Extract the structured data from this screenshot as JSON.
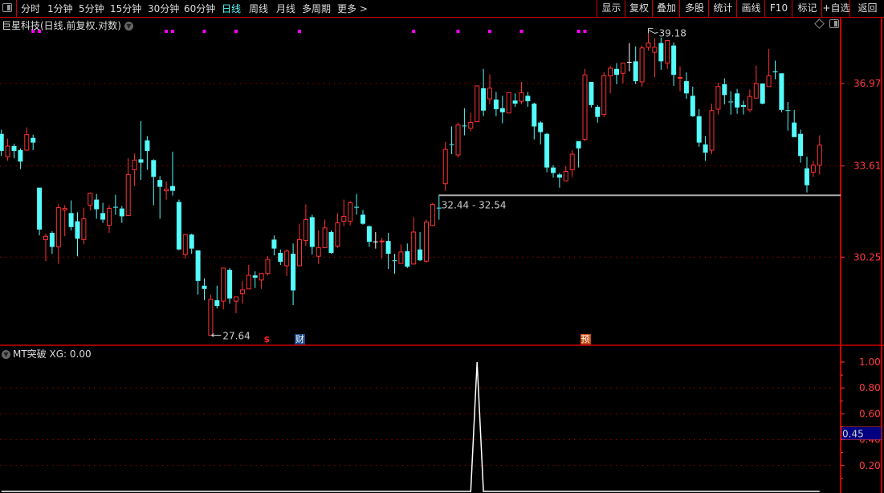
{
  "topbar": {
    "tabs": [
      "分时",
      "1分钟",
      "5分钟",
      "15分钟",
      "30分钟",
      "60分钟",
      "日线",
      "周线",
      "月线",
      "多周期",
      "更多 >"
    ],
    "active_tab": "日线",
    "buttons": [
      "显示",
      "复权",
      "叠加",
      "多股",
      "统计",
      "画线",
      "F10",
      "标记",
      "+自选",
      "返回"
    ]
  },
  "main": {
    "title": "巨星科技(日线.前复权.对数)",
    "price_ticks": [
      36.97,
      33.61,
      30.25
    ],
    "scale": "log",
    "high_label": "39.18",
    "low_label": "27.64",
    "range_label": "32.44 - 32.54",
    "range_line_price": 32.49,
    "event_markers": [
      {
        "candle": 42,
        "text": "$",
        "kind": "dividend"
      },
      {
        "candle": 47,
        "text": "财",
        "kind": "report"
      },
      {
        "candle": 92,
        "text": "预",
        "kind": "forecast"
      }
    ],
    "signal_marks": [
      5,
      6,
      26,
      27,
      32,
      37,
      47,
      65,
      72,
      77,
      82,
      91,
      92
    ],
    "candles": [
      [
        34.88,
        35.05,
        34.0,
        34.2
      ],
      [
        33.97,
        34.69,
        33.81,
        34.39
      ],
      [
        34.39,
        34.49,
        33.91,
        34.2
      ],
      [
        34.23,
        34.3,
        33.49,
        33.78
      ],
      [
        34.23,
        35.14,
        34.23,
        34.85
      ],
      [
        34.72,
        34.85,
        34.23,
        34.53
      ],
      [
        32.78,
        32.78,
        31.02,
        31.23
      ],
      [
        30.87,
        31.08,
        30.11,
        30.99
      ],
      [
        31.11,
        31.17,
        30.37,
        30.61
      ],
      [
        30.61,
        32.18,
        30.01,
        32.03
      ],
      [
        31.94,
        32.12,
        30.99,
        32.0
      ],
      [
        31.83,
        32.3,
        31.2,
        31.32
      ],
      [
        31.53,
        31.86,
        30.28,
        30.9
      ],
      [
        30.87,
        32.03,
        30.7,
        31.62
      ],
      [
        32.12,
        32.6,
        31.92,
        32.57
      ],
      [
        32.33,
        32.54,
        31.62,
        31.97
      ],
      [
        31.83,
        32.21,
        31.47,
        31.59
      ],
      [
        31.38,
        32.12,
        31.11,
        32.0
      ],
      [
        32.06,
        32.51,
        31.77,
        32.03
      ],
      [
        32.0,
        32.09,
        31.47,
        31.71
      ],
      [
        31.74,
        33.91,
        31.74,
        33.28
      ],
      [
        33.46,
        34.1,
        32.84,
        33.84
      ],
      [
        33.87,
        35.4,
        33.07,
        33.74
      ],
      [
        34.62,
        34.79,
        33.46,
        34.2
      ],
      [
        33.84,
        33.87,
        32.12,
        33.19
      ],
      [
        33.07,
        33.22,
        31.62,
        32.81
      ],
      [
        32.66,
        33.02,
        32.33,
        32.72
      ],
      [
        32.84,
        34.17,
        32.48,
        32.66
      ],
      [
        32.24,
        32.33,
        30.49,
        30.52
      ],
      [
        30.34,
        31.05,
        30.2,
        31.05
      ],
      [
        31.05,
        31.08,
        30.37,
        30.55
      ],
      [
        30.49,
        30.49,
        28.97,
        29.43
      ],
      [
        29.27,
        29.52,
        28.78,
        29.16
      ],
      [
        27.64,
        28.97,
        27.64,
        28.81
      ],
      [
        28.78,
        29.27,
        28.51,
        28.59
      ],
      [
        28.75,
        29.87,
        28.48,
        29.87
      ],
      [
        29.81,
        29.87,
        28.67,
        28.84
      ],
      [
        28.75,
        28.89,
        28.35,
        28.89
      ],
      [
        29.0,
        29.43,
        28.67,
        29.13
      ],
      [
        29.16,
        29.98,
        29.16,
        29.62
      ],
      [
        29.62,
        29.76,
        29.19,
        29.54
      ],
      [
        29.46,
        29.68,
        29.16,
        29.68
      ],
      [
        29.68,
        30.28,
        29.62,
        30.17
      ],
      [
        30.87,
        31.02,
        30.31,
        30.55
      ],
      [
        30.4,
        30.52,
        29.98,
        30.09
      ],
      [
        29.95,
        30.52,
        29.6,
        30.46
      ],
      [
        30.37,
        30.73,
        28.62,
        29.11
      ],
      [
        29.95,
        31.44,
        29.95,
        30.87
      ],
      [
        30.84,
        32.15,
        30.64,
        31.59
      ],
      [
        31.68,
        31.77,
        30.34,
        30.61
      ],
      [
        30.28,
        31.2,
        30.01,
        30.58
      ],
      [
        30.58,
        31.59,
        30.58,
        31.29
      ],
      [
        31.14,
        31.2,
        30.37,
        30.4
      ],
      [
        30.64,
        31.83,
        30.58,
        31.47
      ],
      [
        31.53,
        32.33,
        31.35,
        31.71
      ],
      [
        31.53,
        32.27,
        31.38,
        32.21
      ],
      [
        32.06,
        32.54,
        31.77,
        32.03
      ],
      [
        31.77,
        31.94,
        31.41,
        31.44
      ],
      [
        31.35,
        31.38,
        30.61,
        30.79
      ],
      [
        30.79,
        31.14,
        30.55,
        30.79
      ],
      [
        30.79,
        30.93,
        30.2,
        30.82
      ],
      [
        30.82,
        31.11,
        29.84,
        30.37
      ],
      [
        30.14,
        30.37,
        29.68,
        30.11
      ],
      [
        30.03,
        30.7,
        30.03,
        30.43
      ],
      [
        30.46,
        30.73,
        29.87,
        29.92
      ],
      [
        30.01,
        31.68,
        30.01,
        31.14
      ],
      [
        30.52,
        31.14,
        30.11,
        30.14
      ],
      [
        30.11,
        31.59,
        30.06,
        31.5
      ],
      [
        31.38,
        32.21,
        31.35,
        32.15
      ],
      [
        32.03,
        32.51,
        31.59,
        32.0
      ],
      [
        32.93,
        34.56,
        32.66,
        34.26
      ],
      [
        34.45,
        35.18,
        34.07,
        34.43
      ],
      [
        34.04,
        35.34,
        33.94,
        35.24
      ],
      [
        35.2,
        35.93,
        34.82,
        35.18
      ],
      [
        35.11,
        35.73,
        34.98,
        35.34
      ],
      [
        35.37,
        36.87,
        35.37,
        36.87
      ],
      [
        36.77,
        37.6,
        35.6,
        35.83
      ],
      [
        36.32,
        37.37,
        36.09,
        36.77
      ],
      [
        36.29,
        36.61,
        35.6,
        35.89
      ],
      [
        35.93,
        36.45,
        35.31,
        35.76
      ],
      [
        35.73,
        36.58,
        35.73,
        36.58
      ],
      [
        36.25,
        36.55,
        35.99,
        36.12
      ],
      [
        36.22,
        37.04,
        36.09,
        36.58
      ],
      [
        36.45,
        36.61,
        35.99,
        36.22
      ],
      [
        36.12,
        36.16,
        34.66,
        35.18
      ],
      [
        35.34,
        35.4,
        34.46,
        34.95
      ],
      [
        34.88,
        34.92,
        33.37,
        33.55
      ],
      [
        33.55,
        33.64,
        33.16,
        33.34
      ],
      [
        33.28,
        33.34,
        32.78,
        33.16
      ],
      [
        33.04,
        33.61,
        33.02,
        33.4
      ],
      [
        33.46,
        34.23,
        33.19,
        34.07
      ],
      [
        34.59,
        34.59,
        33.55,
        34.3
      ],
      [
        34.66,
        37.6,
        34.59,
        37.34
      ],
      [
        37.04,
        37.04,
        35.96,
        36.06
      ],
      [
        35.99,
        36.06,
        35.34,
        35.57
      ],
      [
        35.67,
        37.45,
        35.57,
        37.3
      ],
      [
        37.3,
        37.74,
        36.55,
        37.63
      ],
      [
        37.6,
        37.85,
        36.94,
        37.34
      ],
      [
        37.41,
        37.85,
        36.97,
        37.85
      ],
      [
        37.89,
        38.74,
        37.49,
        37.89
      ],
      [
        37.93,
        38.59,
        36.94,
        37.07
      ],
      [
        37.04,
        38.63,
        36.84,
        38.52
      ],
      [
        38.55,
        39.18,
        38.41,
        38.74
      ],
      [
        38.33,
        38.96,
        37.23,
        38.55
      ],
      [
        38.74,
        38.99,
        37.56,
        37.93
      ],
      [
        37.85,
        38.88,
        37.6,
        38.85
      ],
      [
        38.63,
        38.77,
        36.87,
        37.34
      ],
      [
        37.2,
        37.71,
        36.64,
        37.23
      ],
      [
        37.07,
        37.45,
        36.32,
        36.55
      ],
      [
        36.45,
        36.84,
        35.57,
        35.6
      ],
      [
        35.6,
        35.89,
        34.36,
        34.53
      ],
      [
        34.46,
        34.79,
        33.81,
        34.13
      ],
      [
        34.23,
        36.12,
        34.07,
        35.83
      ],
      [
        35.89,
        37.01,
        35.67,
        36.84
      ],
      [
        36.94,
        37.19,
        36.09,
        36.48
      ],
      [
        36.19,
        36.64,
        35.67,
        36.16
      ],
      [
        36.55,
        36.74,
        35.7,
        35.96
      ],
      [
        36.06,
        36.25,
        35.67,
        35.99
      ],
      [
        35.86,
        36.71,
        35.76,
        36.42
      ],
      [
        36.35,
        37.74,
        36.35,
        36.97
      ],
      [
        36.97,
        36.97,
        36.09,
        36.12
      ],
      [
        36.84,
        38.48,
        36.84,
        37.3
      ],
      [
        37.49,
        37.96,
        37.15,
        37.45
      ],
      [
        37.41,
        37.41,
        35.76,
        35.86
      ],
      [
        35.83,
        36.19,
        35.01,
        35.8
      ],
      [
        35.34,
        35.86,
        34.75,
        34.75
      ],
      [
        34.88,
        35.05,
        33.74,
        34.0
      ],
      [
        33.52,
        33.97,
        32.6,
        32.87
      ],
      [
        33.37,
        33.81,
        33.19,
        33.64
      ],
      [
        33.64,
        34.82,
        33.28,
        34.43
      ]
    ]
  },
  "indicator": {
    "name": "MT突破",
    "label": "MT突破  XG: 0.00",
    "ticks": [
      "1.00",
      "0.80",
      "0.60",
      "0.40",
      "0.20"
    ],
    "cursor_value": "0.45",
    "xg_signal_candle": 75,
    "xg_peak": 1.0
  },
  "colors": {
    "up": "#ff3232",
    "down": "#54fcfc",
    "flat": "#ffffff",
    "axis": "#ff3c3c",
    "grid": "#a00000",
    "signal": "#ff00ff",
    "active_tab": "#54fcfc",
    "cursor_bg": "#000080"
  }
}
